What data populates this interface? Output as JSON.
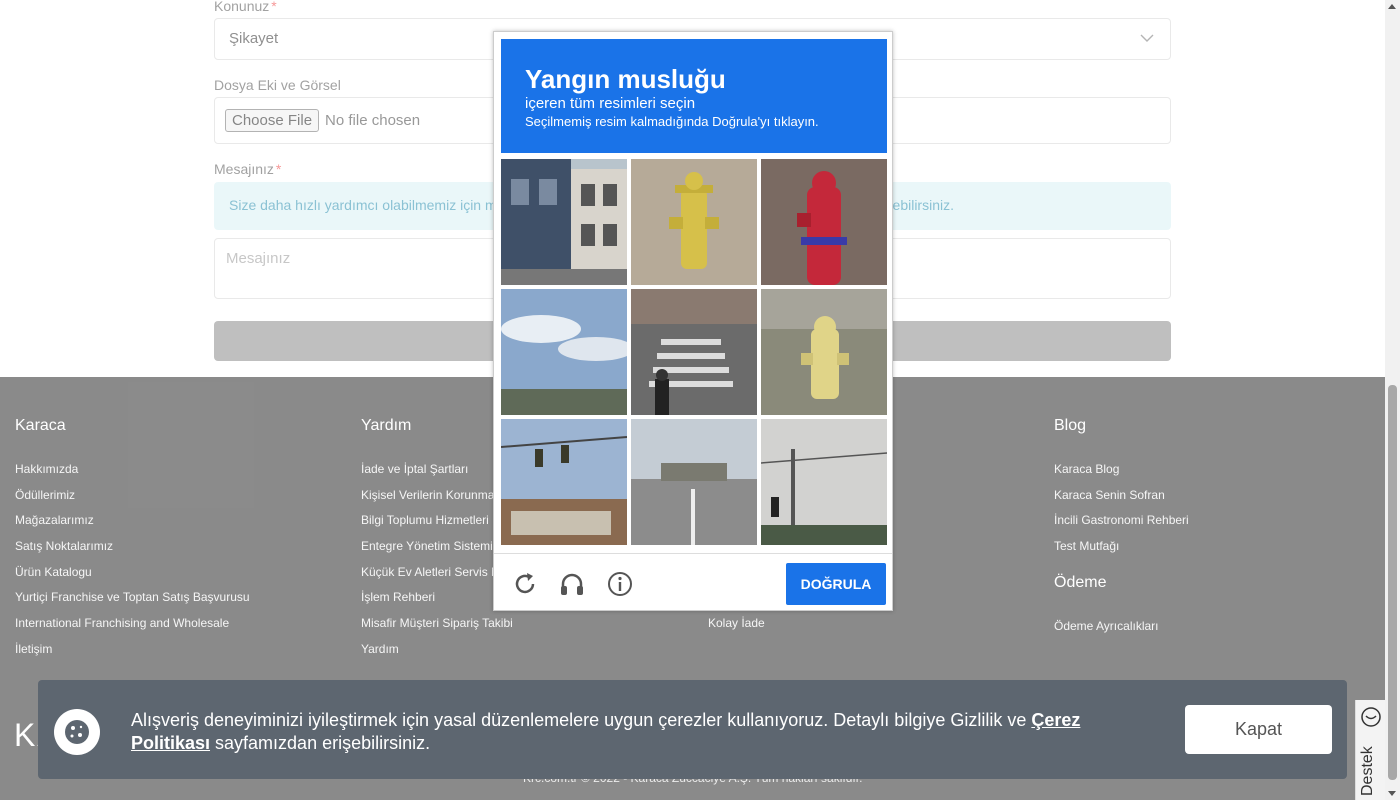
{
  "form": {
    "subject_label": "Konunuz",
    "subject_value": "Şikayet",
    "attachment_label": "Dosya Eki ve Görsel",
    "file_button": "Choose File",
    "file_status": "No file chosen",
    "message_label": "Mesajınız",
    "info_text_left": "Size daha hızlı yardımcı olabilmemiz için me",
    "info_text_right": "ebilirsiniz.",
    "message_placeholder": "Mesajınız",
    "required_mark": "*"
  },
  "footer": {
    "col1": {
      "title": "Karaca",
      "items": [
        "Hakkımızda",
        "Ödüllerimiz",
        "Mağazalarımız",
        "Satış Noktalarımız",
        "Ürün Katalogu",
        "Yurtiçi Franchise ve Toptan Satış Başvurusu",
        "International Franchising and Wholesale",
        "İletişim"
      ]
    },
    "col2": {
      "title": "Yardım",
      "items": [
        "İade ve İptal Şartları",
        "Kişisel Verilerin Korunma",
        "Bilgi Toplumu Hizmetleri",
        "Entegre Yönetim Sistemi",
        "Küçük Ev Aletleri Servis N",
        "İşlem Rehberi",
        "Misafir Müşteri Sipariş Takibi",
        "Yardım"
      ]
    },
    "col3": {
      "items": [
        "Kolay İade"
      ]
    },
    "col4": {
      "title": "Blog",
      "items": [
        "Karaca Blog",
        "Karaca Senin Sofran",
        "İncili Gastronomi Rehberi",
        "Test Mutfağı"
      ],
      "title2": "Ödeme",
      "items2": [
        "Ödeme Ayrıcalıkları"
      ]
    },
    "logo": "KA",
    "copyright": "Krc.com.tr © 2022 - Karaca Züccaciye A.Ş. Tüm hakları saklıdır."
  },
  "cookie": {
    "text": "Alışveriş deneyiminizi iyileştirmek için yasal düzenlemelere uygun çerezler kullanıyoruz. Detaylı bilgiye Gizlilik ve ",
    "link": "Çerez Politikası",
    "text2": " sayfamızdan erişebilirsiniz.",
    "button": "Kapat"
  },
  "support": {
    "label": "Destek"
  },
  "captcha": {
    "title": "Yangın musluğu",
    "subtitle": "içeren tüm resimleri seçin",
    "hint": "Seçilmemiş resim kalmadığında Doğrula'yı tıklayın.",
    "verify_button": "DOĞRULA",
    "tiles": [
      "street-building",
      "yellow-hydrant-closeup",
      "red-hydrant",
      "sky-horizon",
      "crosswalk-pedestrian",
      "yellow-hydrant-grass",
      "traffic-lights",
      "road-traffic-lights",
      "utility-pole-sky"
    ],
    "icons": [
      "reload-icon",
      "audio-icon",
      "info-icon"
    ]
  },
  "colors": {
    "captcha_blue": "#1a73e8",
    "footer_bg": "#2b2b2b",
    "cookie_bg": "#5d6670"
  }
}
